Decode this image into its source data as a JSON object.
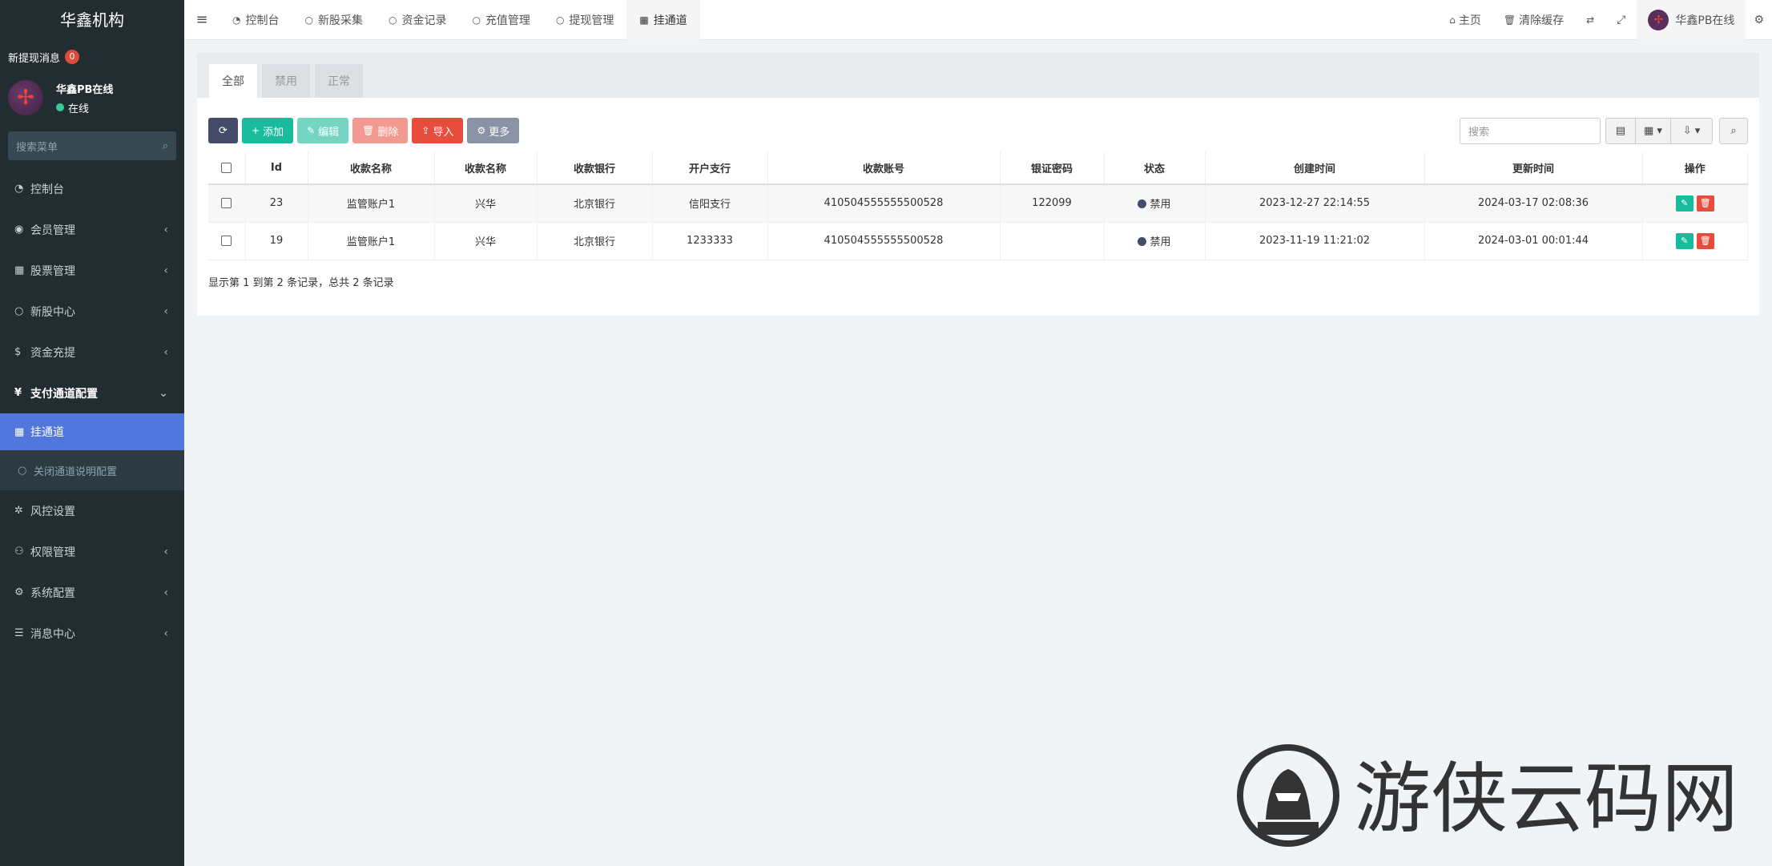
{
  "sidebar": {
    "brand": "华鑫机构",
    "notice_label": "新提现消息",
    "notice_count": "0",
    "user_name": "华鑫PB在线",
    "user_status": "在线",
    "search_placeholder": "搜索菜单",
    "menu": [
      {
        "label": "控制台",
        "icon": "dashboard-icon"
      },
      {
        "label": "会员管理",
        "icon": "user-circle-icon"
      },
      {
        "label": "股票管理",
        "icon": "bank-icon"
      },
      {
        "label": "新股中心",
        "icon": "circle-icon"
      },
      {
        "label": "资金充提",
        "icon": "dollar-icon"
      },
      {
        "label": "支付通道配置",
        "icon": "yen-icon"
      },
      {
        "label": "挂通道",
        "icon": "bank-icon"
      },
      {
        "label": "关闭通道说明配置",
        "icon": "circle-icon"
      },
      {
        "label": "风控设置",
        "icon": "gear-icon"
      },
      {
        "label": "权限管理",
        "icon": "group-icon"
      },
      {
        "label": "系统配置",
        "icon": "cogs-icon"
      },
      {
        "label": "消息中心",
        "icon": "list-icon"
      }
    ]
  },
  "topbar": {
    "tabs": [
      "控制台",
      "新股采集",
      "资金记录",
      "充值管理",
      "提现管理",
      "挂通道"
    ],
    "home": "主页",
    "clear_cache": "清除缓存",
    "user": "华鑫PB在线"
  },
  "panel": {
    "tabs": [
      "全部",
      "禁用",
      "正常"
    ],
    "buttons": {
      "add": "添加",
      "edit": "编辑",
      "delete": "删除",
      "import": "导入",
      "more": "更多"
    },
    "search_placeholder": "搜索",
    "columns": [
      "Id",
      "收款名称",
      "收款名称",
      "收款银行",
      "开户支行",
      "收款账号",
      "银证密码",
      "状态",
      "创建时间",
      "更新时间",
      "操作"
    ],
    "rows": [
      {
        "id": "23",
        "name": "监管账户1",
        "name2": "兴华",
        "bank": "北京银行",
        "branch": "信阳支行",
        "account": "410504555555500528",
        "pwd": "122099",
        "status": "禁用",
        "created": "2023-12-27 22:14:55",
        "updated": "2024-03-17 02:08:36"
      },
      {
        "id": "19",
        "name": "监管账户1",
        "name2": "兴华",
        "bank": "北京银行",
        "branch": "1233333",
        "account": "410504555555500528",
        "pwd": "",
        "status": "禁用",
        "created": "2023-11-19 11:21:02",
        "updated": "2024-03-01 00:01:44"
      }
    ],
    "pager": "显示第 1 到第 2 条记录，总共 2 条记录"
  },
  "watermark": {
    "text": "游侠云码网"
  }
}
